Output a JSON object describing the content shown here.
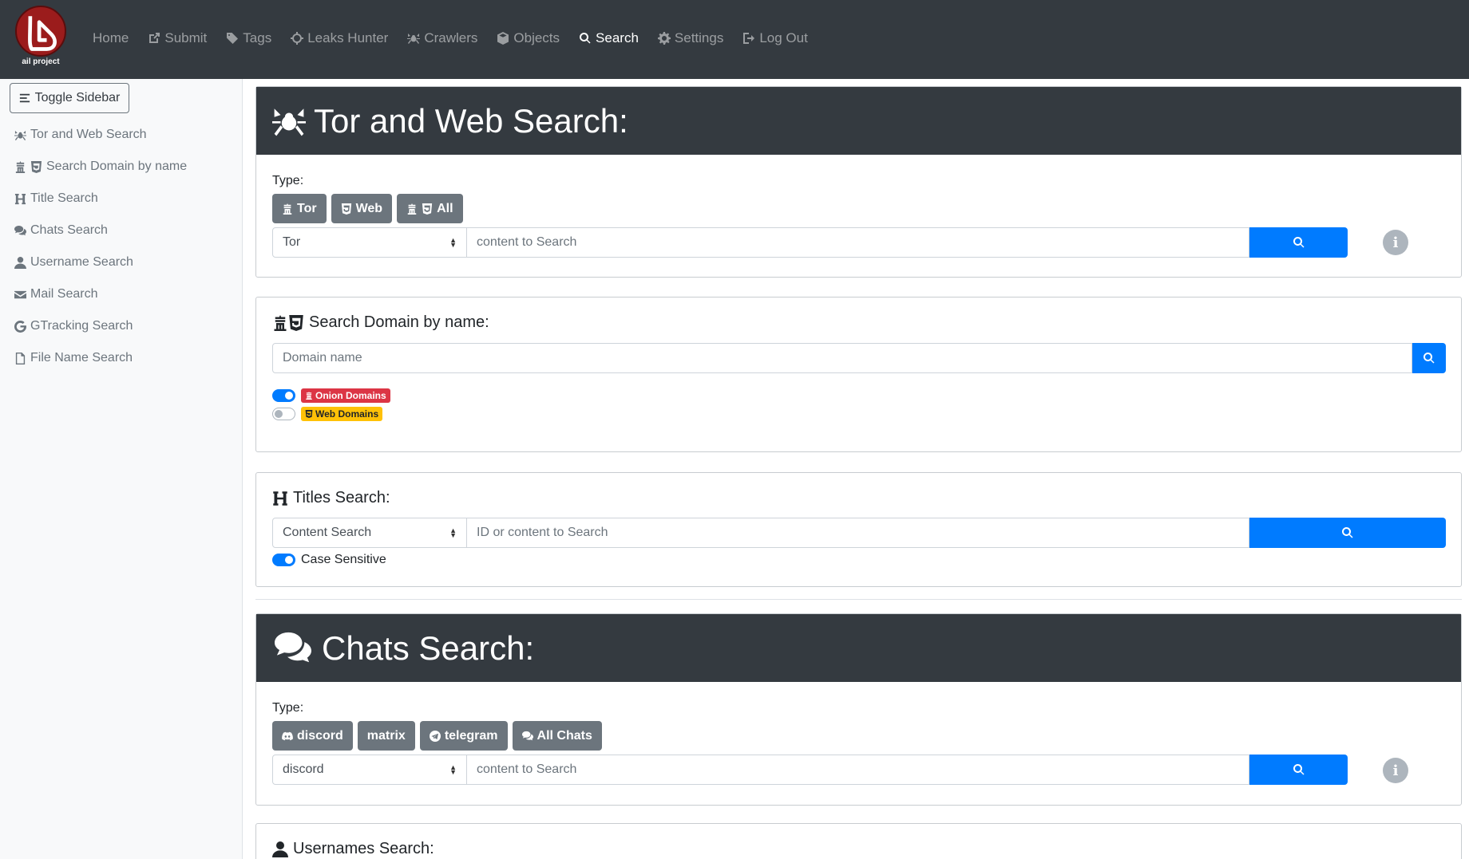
{
  "brand": {
    "logo_text": "ail project"
  },
  "nav": [
    {
      "label": "Home",
      "icon": "none",
      "active": false
    },
    {
      "label": "Submit",
      "icon": "external-link-icon",
      "active": false
    },
    {
      "label": "Tags",
      "icon": "tag-icon",
      "active": false
    },
    {
      "label": "Leaks Hunter",
      "icon": "crosshairs-icon",
      "active": false
    },
    {
      "label": "Crawlers",
      "icon": "spider-icon",
      "active": false
    },
    {
      "label": "Objects",
      "icon": "cube-icon",
      "active": false
    },
    {
      "label": "Search",
      "icon": "search-icon",
      "active": true
    },
    {
      "label": "Settings",
      "icon": "gear-icon",
      "active": false
    },
    {
      "label": "Log Out",
      "icon": "sign-out-icon",
      "active": false
    }
  ],
  "sidebar": {
    "toggle_label": "Toggle Sidebar",
    "items": [
      {
        "label": "Tor and Web Search",
        "icon": "spider-icon"
      },
      {
        "label": "Search Domain by name",
        "icon": "onion-html5-icon"
      },
      {
        "label": "Title Search",
        "icon": "heading-icon"
      },
      {
        "label": "Chats Search",
        "icon": "comments-icon"
      },
      {
        "label": "Username Search",
        "icon": "user-icon"
      },
      {
        "label": "Mail Search",
        "icon": "envelope-icon"
      },
      {
        "label": "GTracking Search",
        "icon": "google-icon"
      },
      {
        "label": "File Name Search",
        "icon": "file-icon"
      }
    ]
  },
  "tor_web": {
    "title": "Tor and Web Search:",
    "type_label": "Type:",
    "types": [
      "Tor",
      "Web",
      "All"
    ],
    "select_value": "Tor",
    "placeholder": "content to Search"
  },
  "domain": {
    "title": "Search Domain by name:",
    "placeholder": "Domain name",
    "onion_label": "Onion Domains",
    "onion_on": true,
    "web_label": "Web Domains",
    "web_on": false
  },
  "titles": {
    "title": "Titles Search:",
    "select_value": "Content Search",
    "placeholder": "ID or content to Search",
    "case_label": "Case Sensitive",
    "case_on": true
  },
  "chats": {
    "title": "Chats Search:",
    "type_label": "Type:",
    "types": [
      "discord",
      "matrix",
      "telegram",
      "All Chats"
    ],
    "select_value": "discord",
    "placeholder": "content to Search"
  },
  "usernames": {
    "title": "Usernames Search:"
  },
  "colors": {
    "navbar": "#343a40",
    "primary": "#007bff",
    "secondary": "#6c757d",
    "danger": "#dc3545",
    "warning": "#ffc107"
  }
}
